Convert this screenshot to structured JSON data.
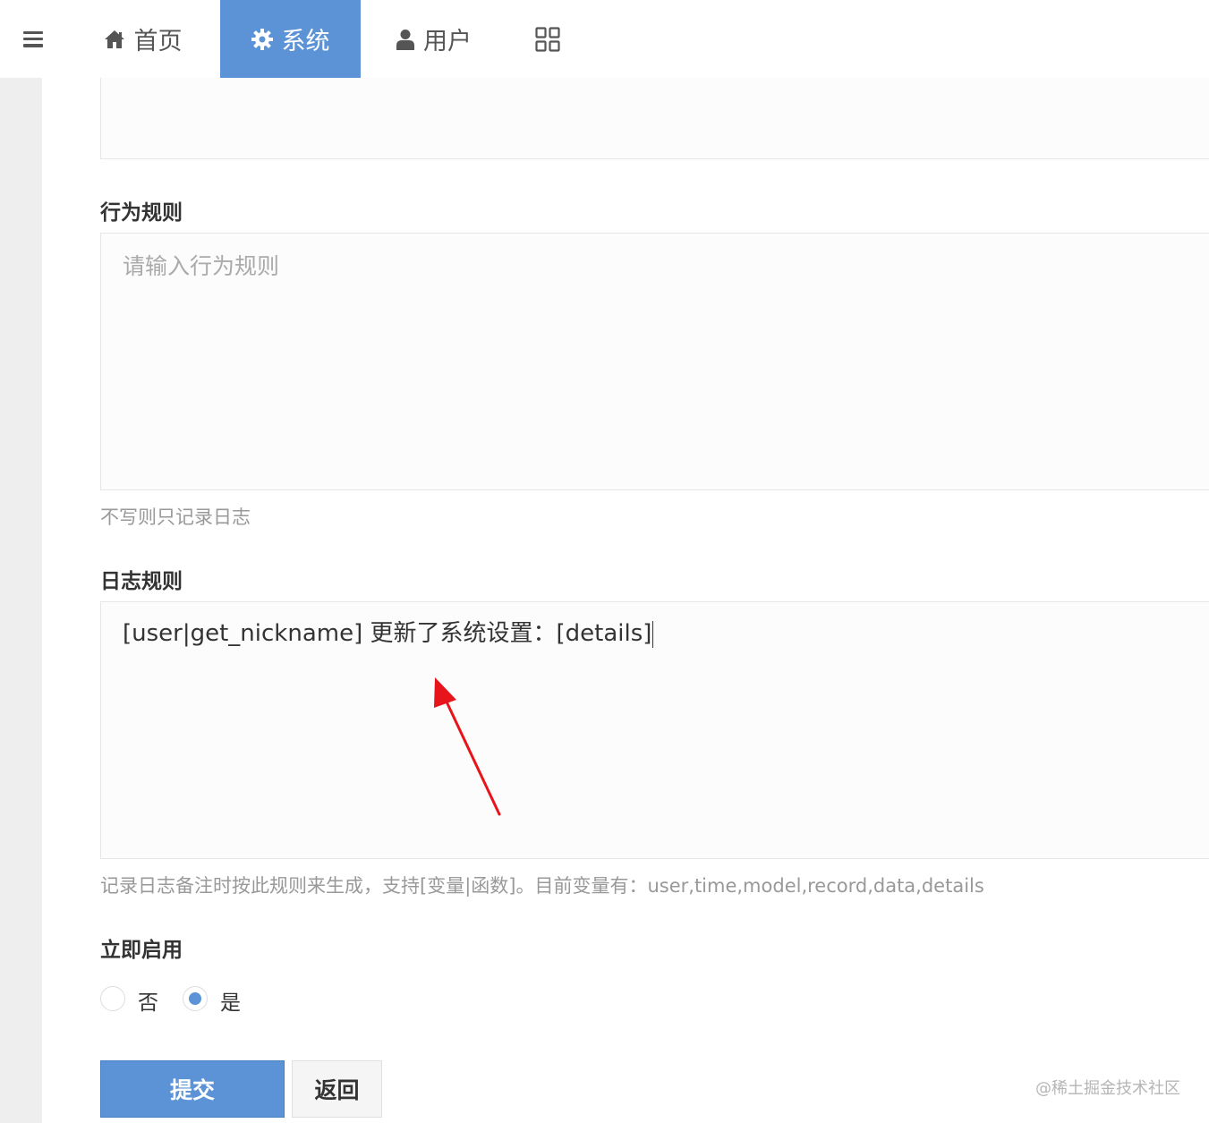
{
  "nav": {
    "menu_icon": "hamburger-icon",
    "tabs": [
      {
        "label": "首页",
        "icon": "home-icon"
      },
      {
        "label": "系统",
        "icon": "gear-icon",
        "active": true
      },
      {
        "label": "用户",
        "icon": "user-icon"
      },
      {
        "label": "",
        "icon": "grid-icon"
      }
    ],
    "active_color": "#5b93d6"
  },
  "form": {
    "behavior_rule": {
      "label": "行为规则",
      "placeholder": "请输入行为规则",
      "help": "不写则只记录日志"
    },
    "log_rule": {
      "label": "日志规则",
      "value": "[user|get_nickname] 更新了系统设置：[details]",
      "help": "记录日志备注时按此规则来生成，支持[变量|函数]。目前变量有：user,time,model,record,data,details"
    },
    "enable_now": {
      "label": "立即启用",
      "options": [
        {
          "label": "否",
          "checked": false
        },
        {
          "label": "是",
          "checked": true
        }
      ]
    },
    "buttons": {
      "submit": "提交",
      "back": "返回"
    }
  },
  "watermark": "@稀土掘金技术社区",
  "annotation": {
    "type": "red-arrow",
    "color": "#e8141c"
  }
}
